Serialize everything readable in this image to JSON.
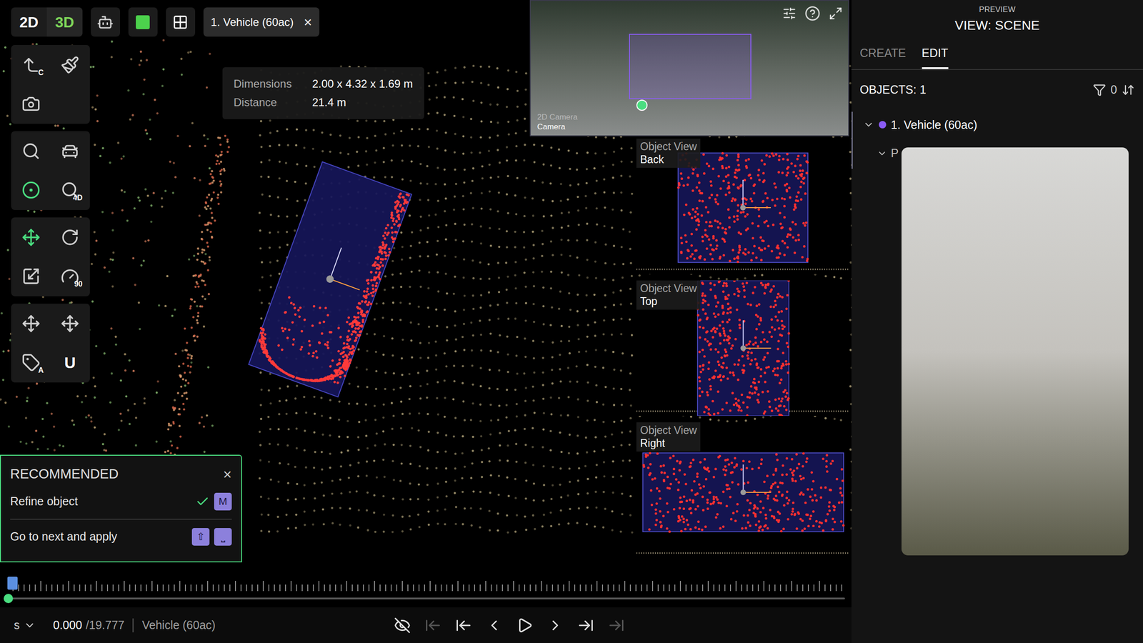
{
  "toolbar": {
    "modes": [
      {
        "label": "2D",
        "selected": false
      },
      {
        "label": "3D",
        "selected": true
      }
    ],
    "object_tab": {
      "label": "1. Vehicle (60ac)",
      "close": "×"
    }
  },
  "tools": [
    {
      "badge": "C"
    },
    {
      "badge": ""
    },
    {
      "badge": ""
    },
    {
      "badge": ""
    },
    {
      "badge": ""
    },
    {
      "badge": ""
    },
    {
      "badge": "4D"
    },
    {
      "badge": ""
    },
    {
      "badge": ""
    },
    {
      "badge": ""
    },
    {
      "badge": "90"
    },
    {
      "badge": ""
    },
    {
      "badge": ""
    },
    {
      "badge": "A"
    },
    {
      "badge": "U"
    }
  ],
  "tooltip": {
    "rows": [
      {
        "label": "Dimensions",
        "value": "2.00 x 4.32 x 1.69 m"
      },
      {
        "label": "Distance",
        "value": "21.4 m"
      }
    ]
  },
  "camera": {
    "title": "2D Camera",
    "subtitle": "Camera"
  },
  "object_views": [
    {
      "title": "Object View",
      "side": "Back"
    },
    {
      "title": "Object View",
      "side": "Top"
    },
    {
      "title": "Object View",
      "side": "Right"
    }
  ],
  "recommended": {
    "title": "RECOMMENDED",
    "close": "×",
    "items": [
      {
        "label": "Refine object",
        "checked": true,
        "keys": [
          "M"
        ]
      },
      {
        "label": "Go to next and apply",
        "checked": false,
        "keys": [
          "⇧",
          "⎵"
        ]
      }
    ]
  },
  "playback": {
    "unit": "s",
    "time": "0.000",
    "duration": "/19.777",
    "object": "Vehicle (60ac)",
    "level": 0.0,
    "controls": [
      {
        "disabled": false
      },
      {
        "disabled": true
      },
      {
        "disabled": false
      },
      {
        "disabled": false
      },
      {
        "disabled": false
      },
      {
        "disabled": false
      },
      {
        "disabled": false
      },
      {
        "disabled": true
      }
    ]
  },
  "sidebar": {
    "header": "PREVIEW",
    "view": "VIEW: SCENE",
    "tabs": [
      {
        "label": "CREATE",
        "selected": false
      },
      {
        "label": "EDIT",
        "selected": true
      }
    ],
    "objects_label": "OBJECTS: 1",
    "filter_count": "0",
    "tree": [
      {
        "label": "1. Vehicle (60ac)",
        "expanded": true,
        "color": "#8b5cf6"
      }
    ],
    "sub_label": "P"
  }
}
